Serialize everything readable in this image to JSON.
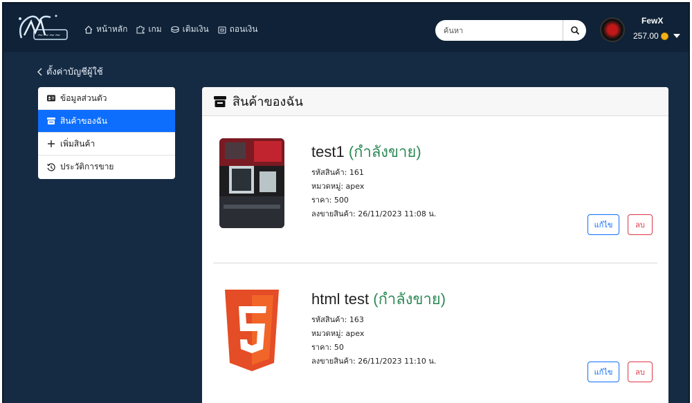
{
  "nav": {
    "home": "หน้าหลัก",
    "games": "เกม",
    "topup": "เติมเงิน",
    "withdraw": "ถอนเงิน"
  },
  "search": {
    "placeholder": "ค้นหา"
  },
  "user": {
    "name": "FewX",
    "balance": "257.00"
  },
  "back_link": "ตั้งค่าบัญชีผู้ใช้",
  "sidebar": {
    "items": [
      {
        "label": "ข้อมูลส่วนตัว",
        "icon": "id-card-icon",
        "active": false
      },
      {
        "label": "สินค้าของฉัน",
        "icon": "store-icon",
        "active": true
      },
      {
        "label": "เพิ่มสินค้า",
        "icon": "plus-icon",
        "active": false
      },
      {
        "label": "ประวัติการขาย",
        "icon": "history-icon",
        "active": false
      }
    ]
  },
  "main": {
    "title": "สินค้าของฉัน",
    "products": [
      {
        "name": "test1",
        "status": "(กำลังขาย)",
        "code": "รหัสสินค้า: 161",
        "category": "หมวดหมู่: apex",
        "price": "ราคา: 500",
        "listed": "ลงขายสินค้า: 26/11/2023 11:08 น.",
        "edit_label": "แก้ไข",
        "delete_label": "ลบ"
      },
      {
        "name": "html test",
        "status": "(กำลังขาย)",
        "code": "รหัสสินค้า: 163",
        "category": "หมวดหมู่: apex",
        "price": "ราคา: 50",
        "listed": "ลงขายสินค้า: 26/11/2023 11:10 น.",
        "edit_label": "แก้ไข",
        "delete_label": "ลบ"
      }
    ]
  },
  "colors": {
    "navbar": "#0f2237",
    "background": "#152b44",
    "accent": "#0d6efd",
    "status_green": "#2e8b57",
    "danger": "#dc3545"
  }
}
